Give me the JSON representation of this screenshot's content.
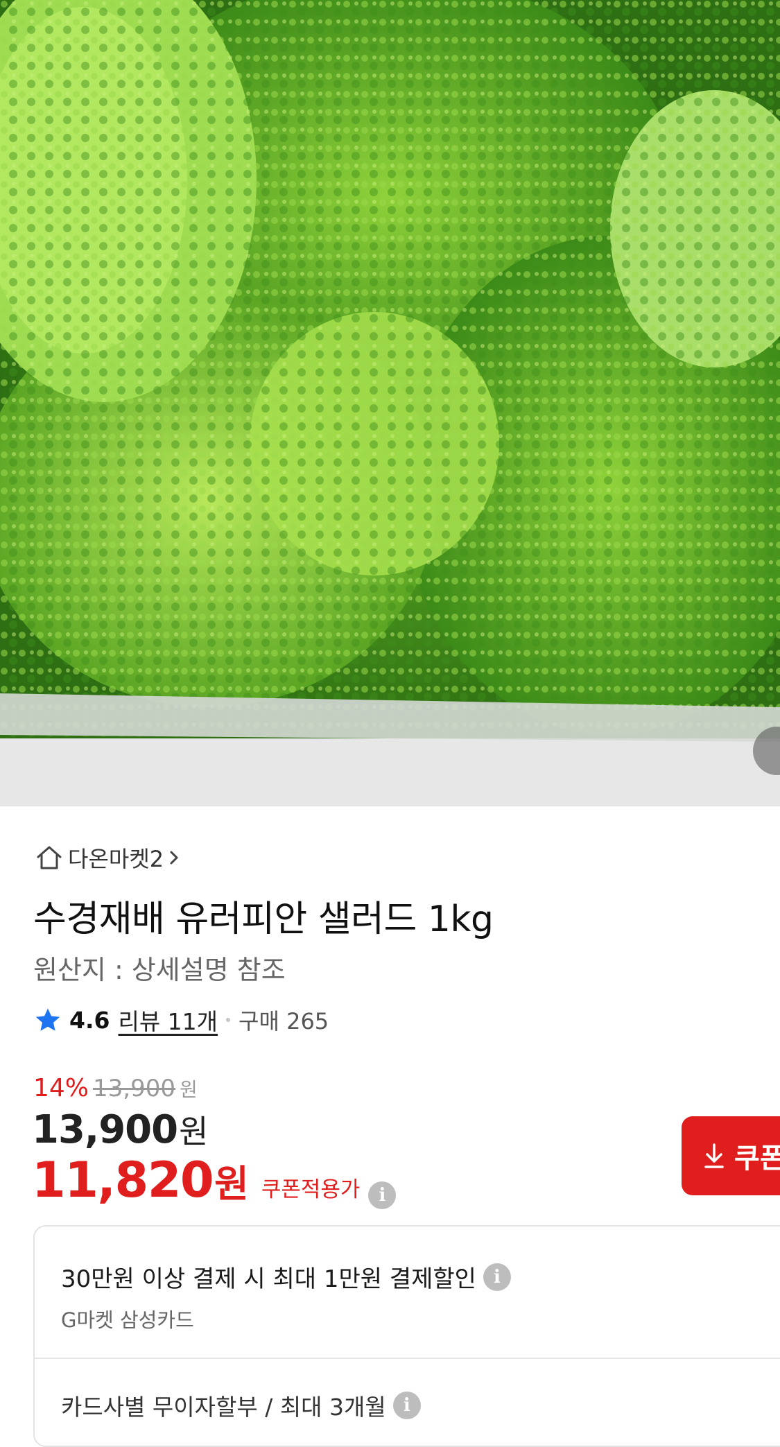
{
  "seller": {
    "icon": "home-icon",
    "name": "다온마켓2",
    "chevron": "chevron-right-icon"
  },
  "product": {
    "title": "수경재배 유러피안 샐러드 1kg",
    "origin": "원산지 : 상세설명 참조",
    "rating": {
      "icon": "star-icon",
      "value": "4.6",
      "reviews_label": "리뷰 11개",
      "purchase_label": "구매 265",
      "star_color": "#1e73f0"
    }
  },
  "price": {
    "discount_rate": "14%",
    "original_price": "13,900",
    "original_unit": "원",
    "sale_price": "13,900",
    "sale_unit": "원",
    "coupon_price": "11,820",
    "coupon_unit": "원",
    "coupon_applied_label": "쿠폰적용가",
    "coupon_button_label": "쿠폰",
    "accent_color": "#e01e1e"
  },
  "card_benefits": {
    "promo_title": "30만원 이상 결제 시 최대 1만원 결제할인",
    "promo_sub": "G마켓 삼성카드",
    "installment": "카드사별 무이자할부 / 최대 3개월"
  },
  "icons": {
    "info": "i",
    "download": "download-icon"
  }
}
